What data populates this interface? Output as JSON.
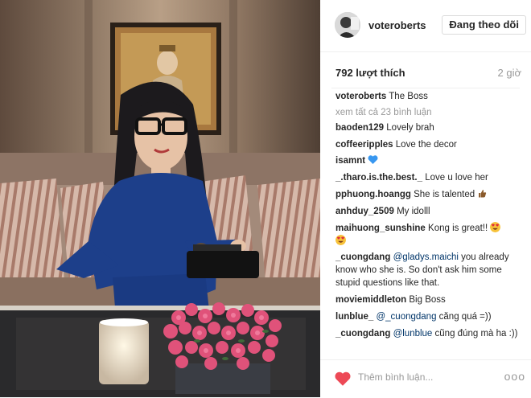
{
  "post": {
    "author": "voteroberts",
    "follow_label": "Đang theo dõi",
    "likes": "792 lượt thích",
    "time": "2 giờ",
    "caption": {
      "user": "voteroberts",
      "text": " The Boss"
    },
    "view_all_comments": "xem tất cả 23 bình luận",
    "comments": [
      {
        "user": "baoden129",
        "text": " Lovely brah"
      },
      {
        "user": "coffeeripples",
        "text": " Love the decor"
      },
      {
        "user": "isamnt",
        "text": " "
      },
      {
        "user": "_.tharo.is.the.best._",
        "text": " Love u love her"
      },
      {
        "user": "pphuong.hoangg",
        "text": " She is talented "
      },
      {
        "user": "anhduy_2509",
        "text": " My idolll"
      },
      {
        "user": "maihuong_sunshine",
        "text": " Kong is great!!"
      },
      {
        "user": "_cuongdang",
        "mention": " @gladys.maichi",
        "text": " you already know who she is. So don't ask him some stupid questions like that."
      },
      {
        "user": "moviemiddleton",
        "text": " Big Boss"
      },
      {
        "user": "lunblue_",
        "mention": " @_cuongdang",
        "text": " căng quá =))"
      },
      {
        "user": "_cuongdang",
        "mention": " @lunblue",
        "text": " cũng đúng mà ha :))"
      }
    ],
    "add_comment_placeholder": "Thêm bình luận...",
    "more_label": "ooo",
    "icons": {
      "like": "heart-icon",
      "more": "ellipsis-icon",
      "blue_heart": "blue-heart-emoji",
      "thumbs_up": "thumbs-up-emoji",
      "heart_eyes": "heart-eyes-emoji"
    },
    "colors": {
      "like_red": "#ed4956",
      "blue_heart": "#3897f0",
      "muted_text": "#999999",
      "mention": "#003569"
    }
  }
}
